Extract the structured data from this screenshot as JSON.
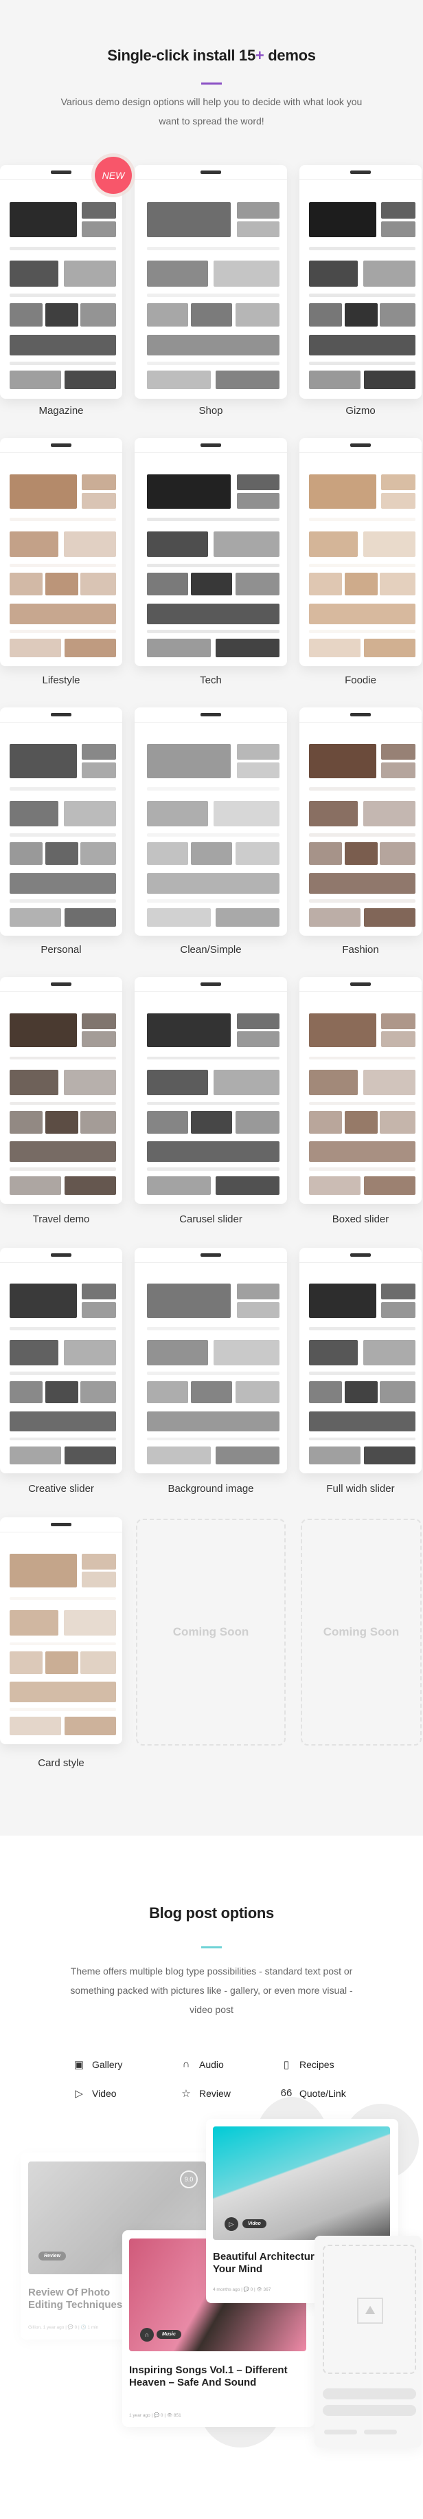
{
  "demos_section": {
    "title_start": "Single-click install 15",
    "title_plus": "+",
    "title_end": " demos",
    "accent": "#8a4fc4",
    "lead": "Various demo design options will help you to decide with what look you want to spread the word!",
    "new_badge": "NEW",
    "items": [
      {
        "label": "Magazine",
        "tone": "#2a2a2a"
      },
      {
        "label": "Shop",
        "tone": "#6d6d6d"
      },
      {
        "label": "Gizmo",
        "tone": "#1d1d1d"
      },
      {
        "label": "Lifestyle",
        "tone": "#b48a6a"
      },
      {
        "label": "Tech",
        "tone": "#222222"
      },
      {
        "label": "Foodie",
        "tone": "#c9a27e"
      },
      {
        "label": "Personal",
        "tone": "#555555"
      },
      {
        "label": "Clean/Simple",
        "tone": "#9a9a9a"
      },
      {
        "label": "Fashion",
        "tone": "#6b4b3b"
      },
      {
        "label": "Travel demo",
        "tone": "#4a3a30"
      },
      {
        "label": "Carusel slider",
        "tone": "#333333"
      },
      {
        "label": "Boxed slider",
        "tone": "#8b6b58"
      },
      {
        "label": "Creative slider",
        "tone": "#3a3a3a"
      },
      {
        "label": "Background image",
        "tone": "#777777"
      },
      {
        "label": "Full widh slider",
        "tone": "#2d2d2d"
      },
      {
        "label": "Card style",
        "tone": "#c4a58a"
      }
    ],
    "coming_soon": [
      "Coming Soon",
      "Coming Soon"
    ]
  },
  "blog_section": {
    "title": "Blog post options",
    "accent": "#6fd3d6",
    "lead": "Theme offers multiple blog type possibilities - standard text post or something packed with pictures like - gallery, or even more visual - video post",
    "options": [
      {
        "label": "Gallery",
        "icon": "gallery-icon",
        "glyph": "▣"
      },
      {
        "label": "Audio",
        "icon": "headphones-icon",
        "glyph": "∩"
      },
      {
        "label": "Recipes",
        "icon": "book-icon",
        "glyph": "▯"
      },
      {
        "label": "Video",
        "icon": "play-icon",
        "glyph": "▷"
      },
      {
        "label": "Review",
        "icon": "star-icon",
        "glyph": "☆"
      },
      {
        "label": "Quote/Link",
        "icon": "quote-icon",
        "glyph": "66"
      }
    ],
    "posts": {
      "review": {
        "tag": "Review",
        "score": "9.0",
        "title": "Review Of Photo Editing Techniques",
        "meta": "Gillion, 1 year ago  |  💬 0  |  🕓 1 min"
      },
      "music": {
        "tag": "Music",
        "title": "Inspiring Songs Vol.1 – Different Heaven – Safe And Sound",
        "meta": "1 year ago  |  💬 0  |  👁 851"
      },
      "video": {
        "tag": "Video",
        "title": "Beautiful Architecture Will Blow Your Mind",
        "meta": "4 months ago  |  💬 0  |  👁 367"
      }
    }
  }
}
